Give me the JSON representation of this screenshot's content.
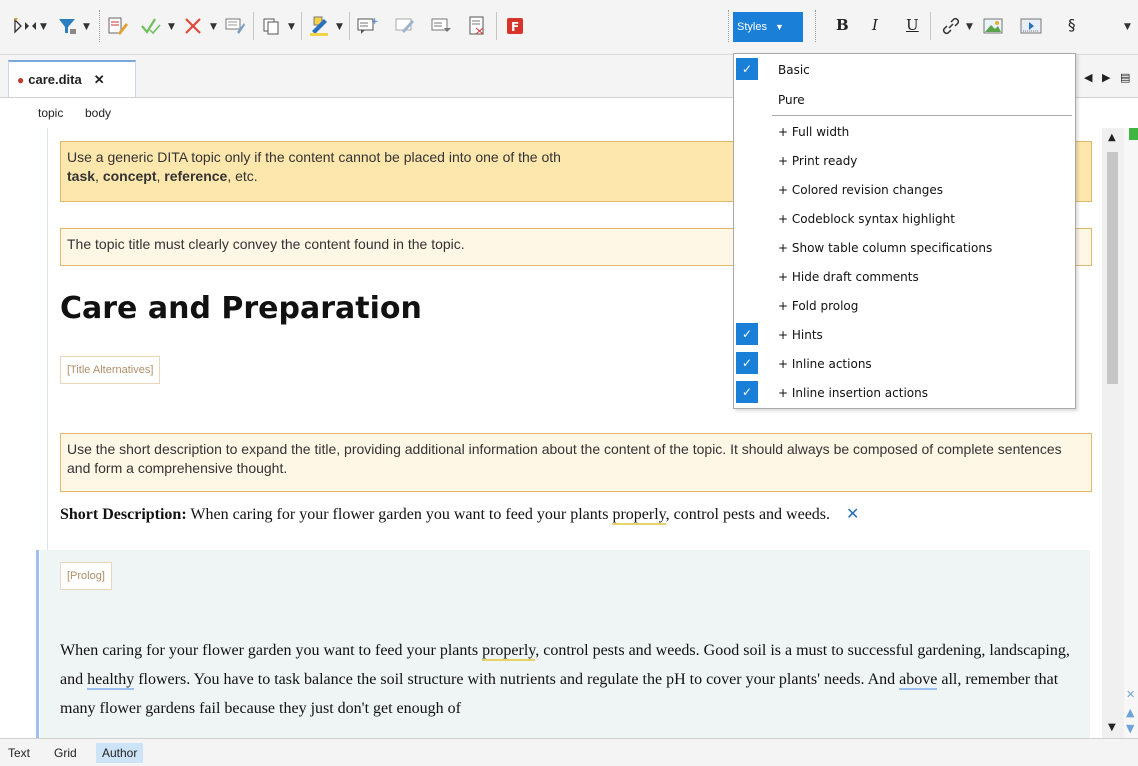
{
  "toolbar": {
    "styles_label": "Styles",
    "bold": "B",
    "italic": "I",
    "underline": "U",
    "section": "§",
    "icons": [
      "track-changes-icon",
      "filter-icon",
      "edit-review-icon",
      "accept-change-icon",
      "reject-change-icon",
      "comment-icon",
      "copy-icon",
      "highlight-icon",
      "insert-comment-icon",
      "edit-comment-icon",
      "remove-comment-icon",
      "manage-reviews-icon",
      "form-controls-icon",
      "link-icon",
      "image-icon",
      "media-icon"
    ]
  },
  "tab": {
    "filename": "care.dita",
    "close": "✕"
  },
  "breadcrumb": [
    "topic",
    "body"
  ],
  "editor": {
    "hint1": {
      "line1": "Use a generic DITA topic only if the content cannot be placed into one of the oth",
      "task": "task",
      "concept": "concept",
      "reference": "reference",
      "rest": ", etc."
    },
    "hint2": "The topic title must clearly convey the content found in the topic.",
    "title": "Care and Preparation",
    "title_alternatives": "[Title Alternatives]",
    "hint3": "Use the short description to expand the title, providing additional information about the content of the topic. It should always be composed of complete sentences and form a comprehensive thought.",
    "short_description": {
      "label": "Short Description:",
      "text_a": "When caring for your flower garden you want to feed your plants",
      "text_u": "properly",
      "text_b": ", control pests and weeds.",
      "delete_icon": "✕"
    },
    "prolog": "[Prolog]",
    "paragraph": {
      "p1": "When caring for your flower garden you want to feed your plants",
      "u1": "properly",
      "p2": ", control pests and weeds. Good soil is a must to successful gardening, landscaping, and",
      "u2": "healthy",
      "p3": "flowers. You have to task balance the soil structure with nutrients and regulate the pH to cover your plants' needs. And",
      "u3": "above",
      "p4": "all, remember that many flower gardens fail because they just don't get enough of"
    }
  },
  "styles_menu": {
    "items": [
      {
        "label": "Basic",
        "checked": true
      },
      {
        "label": "Pure",
        "checked": false
      },
      {
        "label": "+ Full width",
        "checked": false
      },
      {
        "label": "+ Print ready",
        "checked": false
      },
      {
        "label": "+ Colored revision changes",
        "checked": false
      },
      {
        "label": "+ Codeblock syntax highlight",
        "checked": false
      },
      {
        "label": "+ Show table column specifications",
        "checked": false
      },
      {
        "label": "+ Hide draft comments",
        "checked": false
      },
      {
        "label": "+ Fold prolog",
        "checked": false
      },
      {
        "label": "+ Hints",
        "checked": true
      },
      {
        "label": "+ Inline actions",
        "checked": true
      },
      {
        "label": "+ Inline insertion actions",
        "checked": true
      }
    ]
  },
  "modes": [
    "Text",
    "Grid",
    "Author"
  ],
  "active_mode": "Author",
  "colors": {
    "accent": "#1a7fd6",
    "hint_bg": "#fde7ad",
    "hint_border": "#e2b96a",
    "prolog_bg": "#eef5f4"
  }
}
